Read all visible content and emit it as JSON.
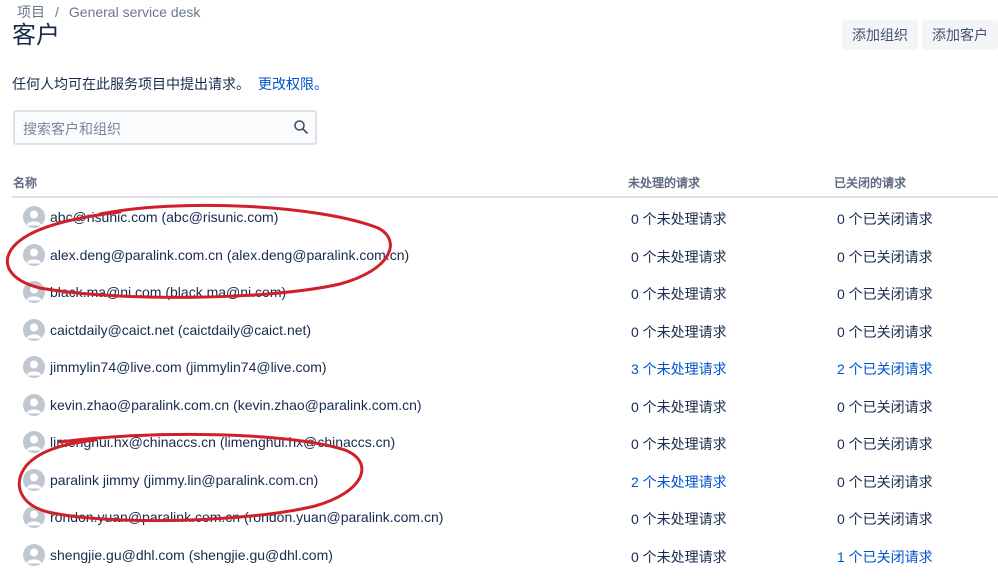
{
  "breadcrumb": {
    "project": "项目",
    "separator": "/",
    "current": "General service desk"
  },
  "header": {
    "title": "客户",
    "add_org_label": "添加组织",
    "add_customer_label": "添加客户"
  },
  "permissions": {
    "text": "任何人均可在此服务项目中提出请求。",
    "link": "更改权限。"
  },
  "search": {
    "placeholder": "搜索客户和组织",
    "icon": "search-icon"
  },
  "table": {
    "headers": {
      "name": "名称",
      "open": "未处理的请求",
      "closed": "已关闭的请求"
    },
    "rows": [
      {
        "name": "abc@risunic.com (abc@risunic.com)",
        "open": "0 个未处理请求",
        "closed": "0 个已关闭请求"
      },
      {
        "name": "alex.deng@paralink.com.cn (alex.deng@paralink.com.cn)",
        "open": "0 个未处理请求",
        "closed": "0 个已关闭请求"
      },
      {
        "name": "black.ma@ni.com (black.ma@ni.com)",
        "open": "0 个未处理请求",
        "closed": "0 个已关闭请求"
      },
      {
        "name": "caictdaily@caict.net (caictdaily@caict.net)",
        "open": "0 个未处理请求",
        "closed": "0 个已关闭请求"
      },
      {
        "name": "jimmylin74@live.com (jimmylin74@live.com)",
        "open": "3 个未处理请求",
        "closed": "2 个已关闭请求"
      },
      {
        "name": "kevin.zhao@paralink.com.cn (kevin.zhao@paralink.com.cn)",
        "open": "0 个未处理请求",
        "closed": "0 个已关闭请求"
      },
      {
        "name": "limenghui.hx@chinaccs.cn (limenghui.hx@chinaccs.cn)",
        "open": "0 个未处理请求",
        "closed": "0 个已关闭请求"
      },
      {
        "name": "paralink jimmy (jimmy.lin@paralink.com.cn)",
        "open": "2 个未处理请求",
        "closed": "0 个已关闭请求"
      },
      {
        "name": "rondon.yuan@paralink.com.cn (rondon.yuan@paralink.com.cn)",
        "open": "0 个未处理请求",
        "closed": "0 个已关闭请求"
      },
      {
        "name": "shengjie.gu@dhl.com (shengjie.gu@dhl.com)",
        "open": "0 个未处理请求",
        "closed": "1 个已关闭请求"
      }
    ]
  },
  "colors": {
    "link": "#0052cc",
    "text": "#172b4d",
    "annotation": "#d0202a"
  }
}
